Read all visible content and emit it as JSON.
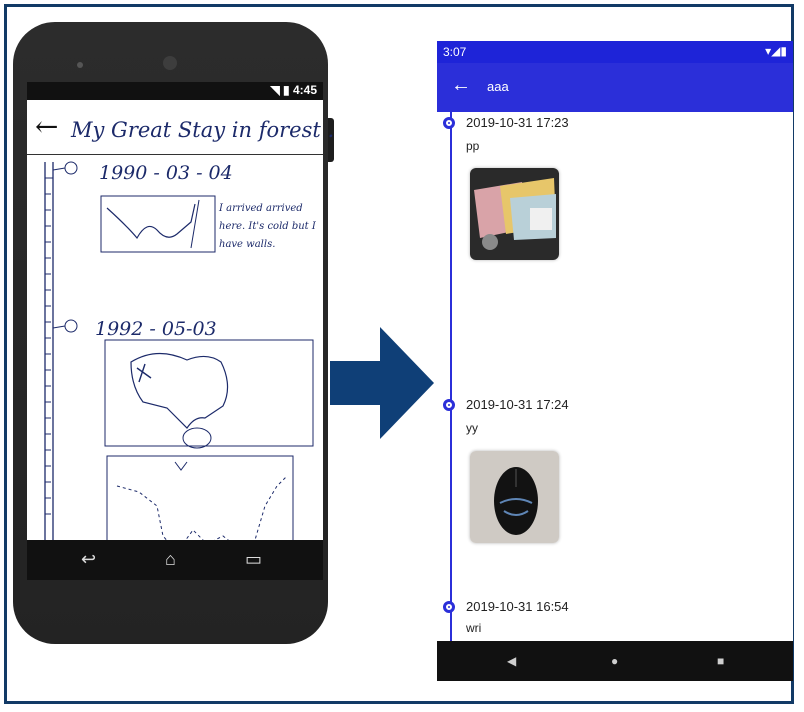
{
  "left_phone": {
    "status_text": "4:45",
    "sketch_title": "My Great Stay in forest .",
    "entries": [
      {
        "date": "1990 - 03 - 04",
        "note": "I arrived arrived here. It's cold but I have walls."
      },
      {
        "date": "1992 - 05-03"
      }
    ]
  },
  "right_phone": {
    "status_time": "3:07",
    "toolbar_title": "aaa",
    "entries": [
      {
        "date": "2019-10-31 17:23",
        "text": "pp"
      },
      {
        "date": "2019-10-31 17:24",
        "text": "yy"
      },
      {
        "date": "2019-10-31 16:54",
        "text": "wri"
      }
    ]
  },
  "colors": {
    "frame_border": "#123a66",
    "arrow": "#0f3f77",
    "toolbar": "#2b2fd9",
    "timeline": "#2b2fd9"
  }
}
